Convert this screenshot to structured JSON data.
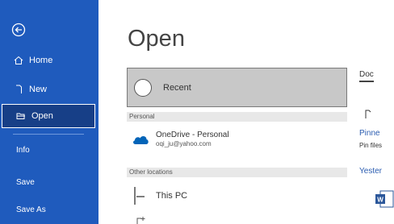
{
  "sidebar": {
    "items": [
      {
        "label": "Home",
        "icon": "home-icon"
      },
      {
        "label": "New",
        "icon": "new-document-icon"
      },
      {
        "label": "Open",
        "icon": "open-folder-icon",
        "selected": true
      }
    ],
    "secondary": [
      {
        "label": "Info"
      },
      {
        "label": "Save"
      },
      {
        "label": "Save As"
      }
    ]
  },
  "main": {
    "title": "Open",
    "recent_label": "Recent",
    "personal_header": "Personal",
    "onedrive_title": "OneDrive - Personal",
    "onedrive_email": "oqi_ju@yahoo.com",
    "other_locations_header": "Other locations",
    "this_pc_label": "This PC"
  },
  "right_panel": {
    "tab_label": "Doc",
    "pinned_label": "Pinne",
    "pinned_text": "Pin files",
    "yesterday_label": "Yester"
  },
  "colors": {
    "sidebar_bg": "#1f5bbd",
    "selected_bg": "#173f87",
    "onedrive_blue": "#0364b8",
    "word_blue": "#2b579a"
  }
}
